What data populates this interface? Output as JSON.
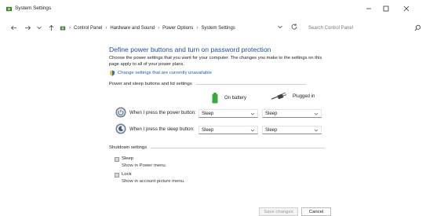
{
  "window": {
    "title": "System Settings",
    "controls": [
      "minimize-icon",
      "maximize-icon",
      "close-icon"
    ]
  },
  "address_bar": {
    "breadcrumbs": [
      "Control Panel",
      "Hardware and Sound",
      "Power Options",
      "System Settings"
    ],
    "search_placeholder": "Search Control Panel"
  },
  "content": {
    "title": "Define power buttons and turn on password protection",
    "intro": "Choose the power settings that you want for your computer. The changes you make to the settings on this page apply to all of your power plans.",
    "change_link": "Change settings that are currently unavailable",
    "power_section": {
      "heading": "Power and sleep buttons and lid settings",
      "columns": {
        "battery": "On battery",
        "plugged": "Plugged in"
      },
      "rows": [
        {
          "label": "When I press the power button:",
          "battery": "Sleep",
          "plugged": "Sleep"
        },
        {
          "label": "When I press the sleep button:",
          "battery": "Sleep",
          "plugged": "Sleep"
        }
      ]
    },
    "shutdown_section": {
      "heading": "Shutdown settings",
      "items": [
        {
          "label": "Sleep",
          "description": "Show in Power menu.",
          "checked": false
        },
        {
          "label": "Lock",
          "description": "Show in account picture menu.",
          "checked": false
        }
      ]
    }
  },
  "footer": {
    "save_label": "Save changes",
    "cancel_label": "Cancel"
  },
  "colors": {
    "title_blue": "#1a4f99",
    "link_blue": "#1a5fb4",
    "battery_green": "#3aa83a"
  }
}
